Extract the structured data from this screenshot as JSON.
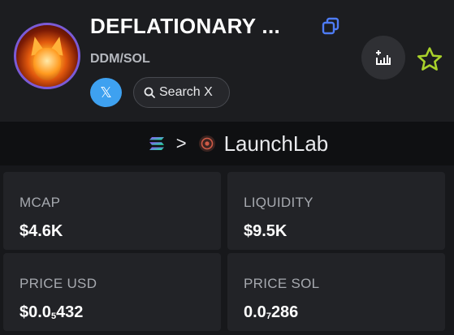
{
  "token": {
    "name": "DEFLATIONARY ...",
    "pair": "DDM/SOL"
  },
  "social": {
    "x_icon_label": "𝕏",
    "search_label": "Search X"
  },
  "launch": {
    "separator": ">",
    "platform": "LaunchLab"
  },
  "stats": {
    "mcap": {
      "label": "MCAP",
      "value": "$4.6K"
    },
    "liquidity": {
      "label": "LIQUIDITY",
      "value": "$9.5K"
    },
    "price_usd": {
      "label": "PRICE USD",
      "prefix": "$0.0",
      "zeros": "5",
      "digits": "432"
    },
    "price_sol": {
      "label": "PRICE SOL",
      "prefix": "0.0",
      "zeros": "7",
      "digits": "286"
    }
  },
  "colors": {
    "accent_blue": "#4e7cf5",
    "x_badge": "#3ea1f0",
    "star": "#a9d22b",
    "background": "#1c1d20"
  },
  "icons": [
    "copy-icon",
    "x-logo-icon",
    "search-icon",
    "add-chart-icon",
    "star-icon",
    "solana-icon",
    "chevron-right-icon",
    "launchlab-icon"
  ]
}
